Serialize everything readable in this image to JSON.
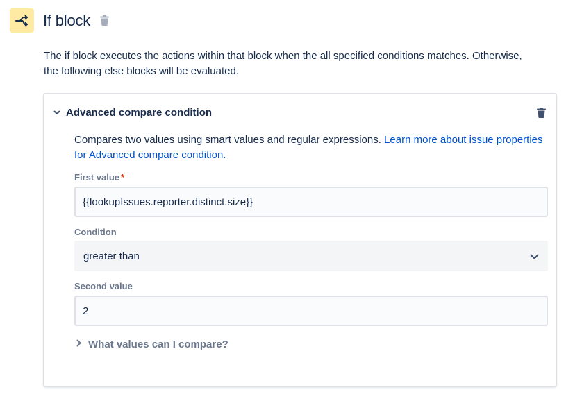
{
  "header": {
    "title": "If block",
    "icon": "branch-icon",
    "icon_bg": "#ffeaa3"
  },
  "description": "The if block executes the actions within that block when the all specified conditions matches. Otherwise, the following else blocks will be evaluated.",
  "condition_card": {
    "title": "Advanced compare condition",
    "description_text": "Compares two values using smart values and regular expressions. ",
    "learn_more_link": "Learn more about issue properties for Advanced compare condition.",
    "first_value": {
      "label": "First value",
      "required_marker": "*",
      "value": "{{lookupIssues.reporter.distinct.size}}"
    },
    "condition": {
      "label": "Condition",
      "selected": "greater than"
    },
    "second_value": {
      "label": "Second value",
      "value": "2"
    },
    "help_expander": "What values can I compare?"
  },
  "colors": {
    "link": "#0052cc",
    "text": "#172b4d",
    "muted": "#6b778c",
    "required": "#de350b"
  }
}
